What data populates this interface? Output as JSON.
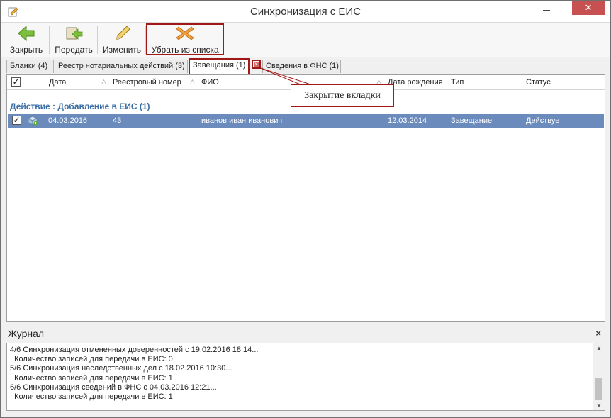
{
  "window": {
    "title": "Синхронизация с ЕИС",
    "close_glyph": "✕",
    "minimize_glyph": "—"
  },
  "toolbar": {
    "close_label": "Закрыть",
    "send_label": "Передать",
    "edit_label": "Изменить",
    "remove_label": "Убрать из списка"
  },
  "tabs": [
    {
      "label": "Бланки (4)"
    },
    {
      "label": "Реестр нотариальных действий (3)"
    },
    {
      "label": "Завещания (1)"
    },
    {
      "label": "Сведения в ФНС (1)"
    }
  ],
  "tab_close_glyph": "×",
  "grid": {
    "columns": [
      "Дата",
      "Реестровый номер",
      "ФИО",
      "Дата рождения",
      "Тип",
      "Статус"
    ],
    "sort_glyph": "△",
    "group_label": "Действие : Добавление в ЕИС (1)",
    "rows": [
      {
        "date": "04.03.2016",
        "reg_number": "43",
        "fio": "иванов иван иванович",
        "birth_date": "12.03.2014",
        "type": "Завещание",
        "status": "Действует",
        "checked": true
      }
    ]
  },
  "annotation": {
    "callout_text": "Закрытие вкладки"
  },
  "journal": {
    "title": "Журнал",
    "close_glyph": "×",
    "lines": [
      "4/6 Синхронизация отмененных доверенностей с 19.02.2016 18:14...",
      "  Количество записей для передачи в ЕИС: 0",
      "5/6 Синхронизация наследственных дел с 18.02.2016 10:30...",
      "  Количество записей для передачи в ЕИС: 1",
      "6/6 Синхронизация сведений в ФНС с 04.03.2016 12:21...",
      "  Количество записей для передачи в ЕИС: 1"
    ]
  },
  "colors": {
    "selected_row": "#6c8bbd",
    "group_text": "#3a6ea5",
    "annotation": "#a01818",
    "close_button": "#c75050"
  }
}
